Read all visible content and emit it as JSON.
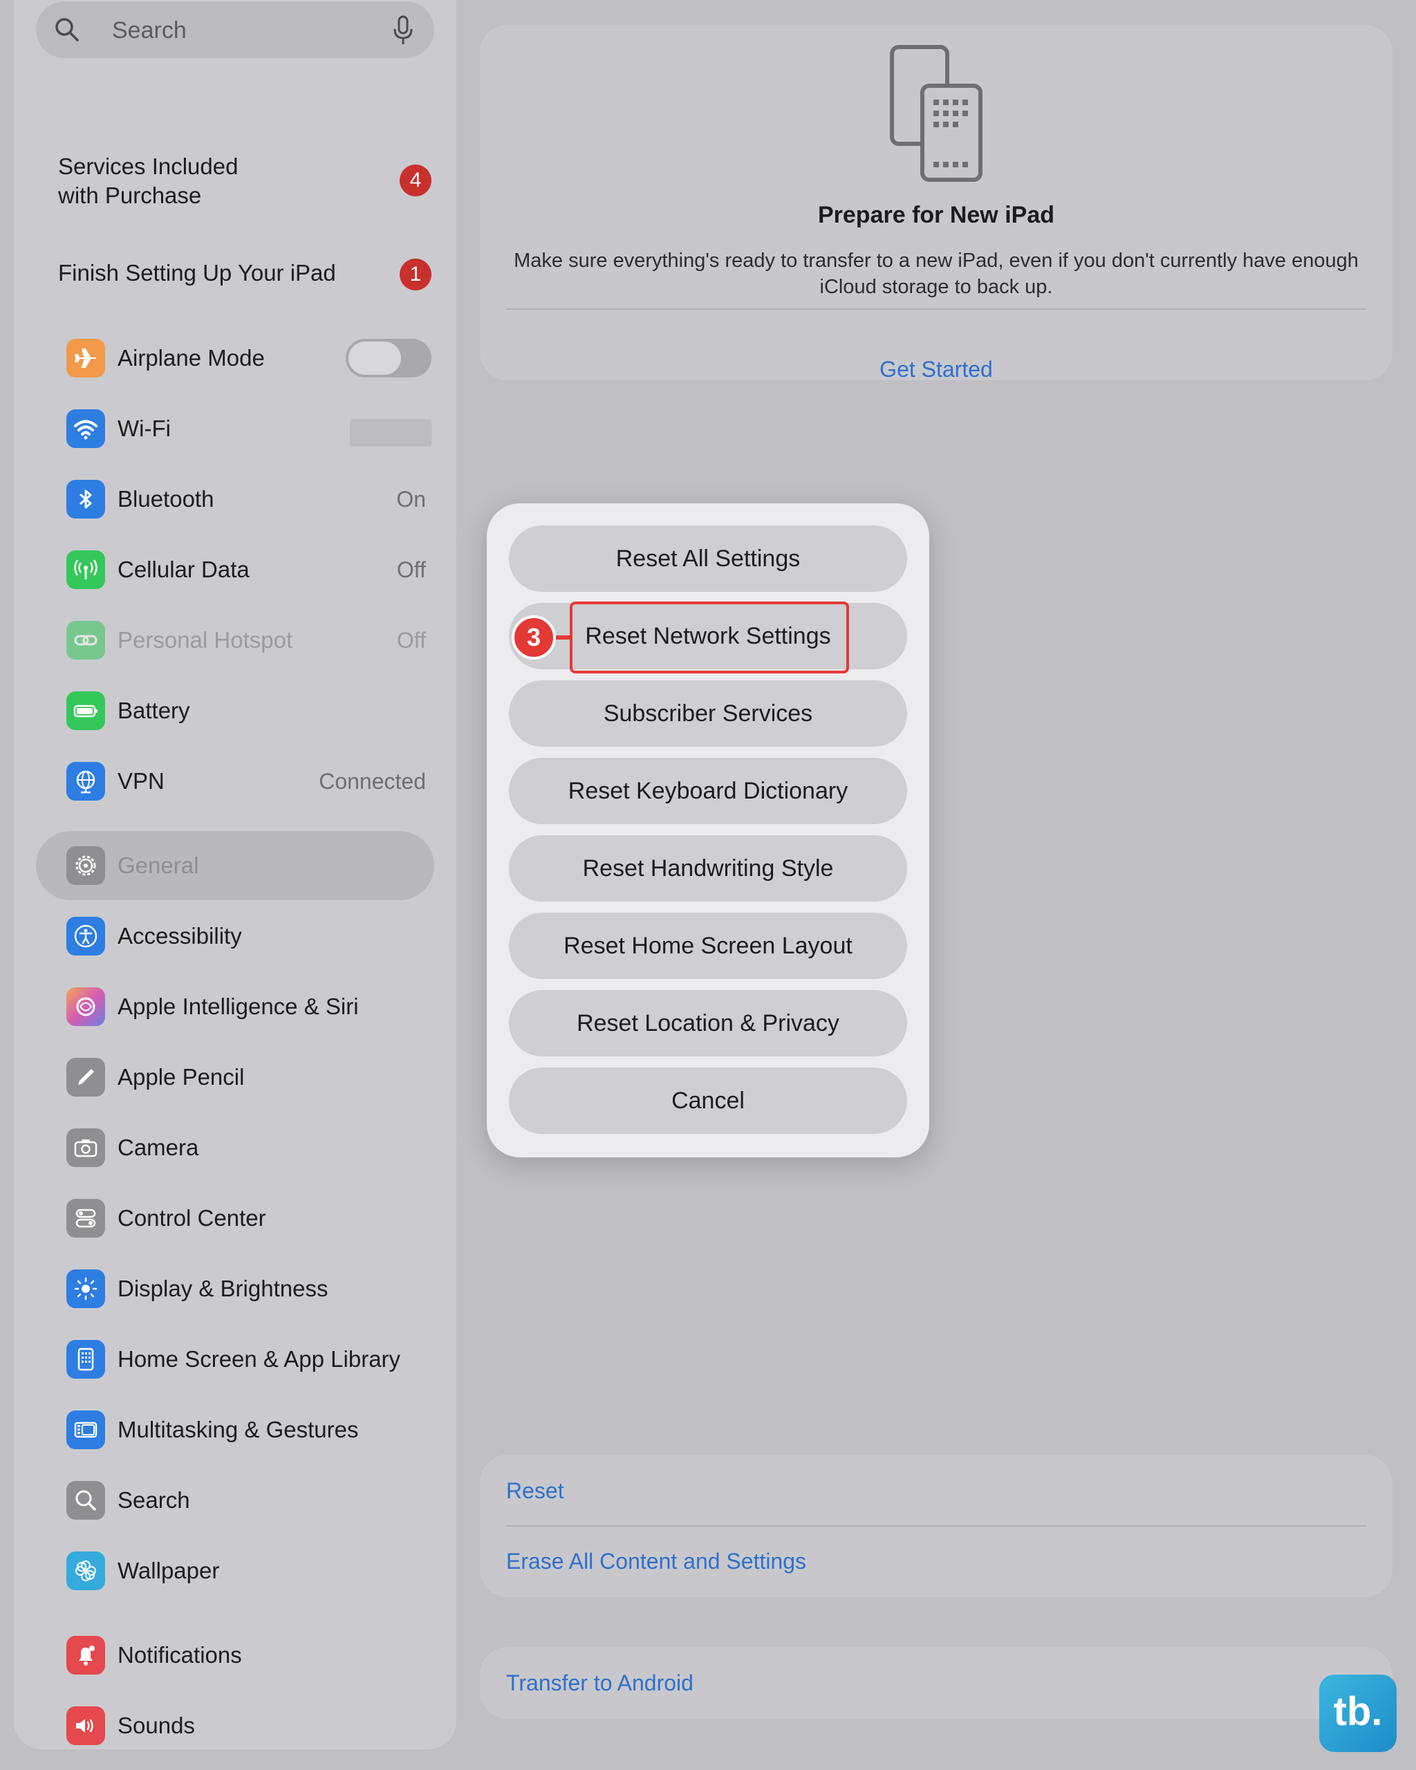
{
  "sidebar": {
    "search_placeholder": "Search",
    "services_label": "Services Included with Purchase",
    "services_badge": "4",
    "finish_label": "Finish Setting Up Your iPad",
    "finish_badge": "1",
    "items": [
      {
        "label": "Airplane Mode",
        "icon": "airplane-icon",
        "color": "#f2994a",
        "toggle": "off"
      },
      {
        "label": "Wi-Fi",
        "icon": "wifi-icon",
        "color": "#2d7de3"
      },
      {
        "label": "Bluetooth",
        "value": "On",
        "icon": "bluetooth-icon",
        "color": "#2d7de3"
      },
      {
        "label": "Cellular Data",
        "value": "Off",
        "icon": "antenna-icon",
        "color": "#34c759"
      },
      {
        "label": "Personal Hotspot",
        "value": "Off",
        "icon": "hotspot-icon",
        "color": "#34c759"
      },
      {
        "label": "Battery",
        "icon": "battery-icon",
        "color": "#34c759"
      },
      {
        "label": "VPN",
        "value": "Connected",
        "icon": "globe-icon",
        "color": "#2d7de3"
      },
      {
        "label": "General",
        "icon": "gear-icon",
        "color": "#8e8e93"
      },
      {
        "label": "Accessibility",
        "icon": "accessibility-icon",
        "color": "#2d7de3"
      },
      {
        "label": "Apple Intelligence & Siri",
        "icon": "siri-icon",
        "color": "#b76ad8"
      },
      {
        "label": "Apple Pencil",
        "icon": "pencil-icon",
        "color": "#8e8e93"
      },
      {
        "label": "Camera",
        "icon": "camera-icon",
        "color": "#8e8e93"
      },
      {
        "label": "Control Center",
        "icon": "switches-icon",
        "color": "#8e8e93"
      },
      {
        "label": "Display & Brightness",
        "icon": "sun-icon",
        "color": "#2d7de3"
      },
      {
        "label": "Home Screen & App Library",
        "icon": "homescreen-icon",
        "color": "#2d7de3"
      },
      {
        "label": "Multitasking & Gestures",
        "icon": "multitask-icon",
        "color": "#2d7de3"
      },
      {
        "label": "Search",
        "icon": "magnifier-icon",
        "color": "#8e8e93"
      },
      {
        "label": "Wallpaper",
        "icon": "flower-icon",
        "color": "#35aadc"
      },
      {
        "label": "Notifications",
        "icon": "bell-icon",
        "color": "#e5484d"
      },
      {
        "label": "Sounds",
        "icon": "speaker-icon",
        "color": "#e5484d"
      }
    ]
  },
  "prepare": {
    "title": "Prepare for New iPad",
    "description": "Make sure everything's ready to transfer to a new iPad, even if you don't currently have enough iCloud storage to back up.",
    "link": "Get Started"
  },
  "reset_card": {
    "reset": "Reset",
    "erase": "Erase All Content and Settings"
  },
  "android": {
    "link": "Transfer to Android"
  },
  "action_sheet": {
    "buttons": [
      "Reset All Settings",
      "Reset Network Settings",
      "Subscriber Services",
      "Reset Keyboard Dictionary",
      "Reset Handwriting Style",
      "Reset Home Screen Layout",
      "Reset Location & Privacy",
      "Cancel"
    ],
    "step_number": "3"
  },
  "watermark": "tb.",
  "colors": {
    "link_blue": "#2f6fce",
    "highlight_red": "#e53935",
    "badge_red": "#c8302c"
  }
}
